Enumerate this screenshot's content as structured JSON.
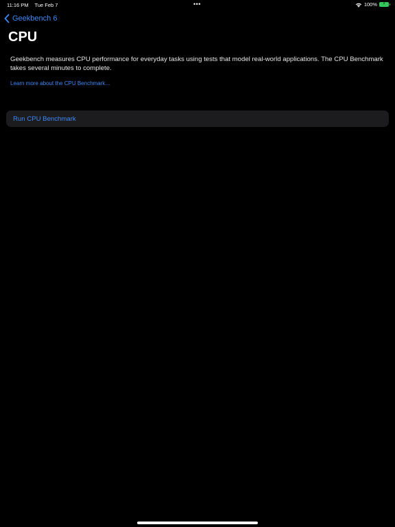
{
  "status_bar": {
    "time": "11:16 PM",
    "date": "Tue Feb 7",
    "multitask_indicator": "•••",
    "battery_percent": "100%",
    "battery_color": "#34c759",
    "wifi_icon": "wifi-icon",
    "battery_icon": "battery-charging-icon"
  },
  "nav": {
    "back_label": "Geekbench 6",
    "back_icon": "chevron-left-icon"
  },
  "page": {
    "title": "CPU",
    "description": "Geekbench measures CPU performance for everyday tasks using tests that model real-world applications. The CPU Benchmark takes several minutes to complete.",
    "learn_more_link": "Learn more about the CPU Benchmark…",
    "run_button_label": "Run CPU Benchmark"
  },
  "colors": {
    "background": "#000000",
    "accent": "#3e88f7",
    "cell_background": "#1c1c1e"
  }
}
